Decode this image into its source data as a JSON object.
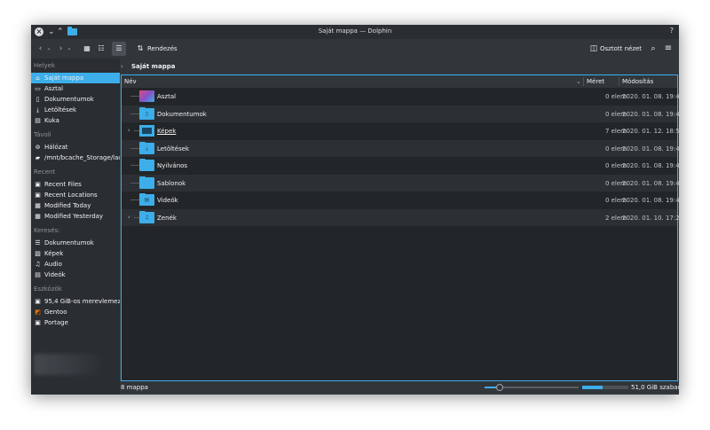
{
  "window": {
    "title": "Saját mappa — Dolphin",
    "help": "?"
  },
  "toolbar": {
    "sort_label": "Rendezés",
    "split_label": "Osztott nézet"
  },
  "sidebar": {
    "places_title": "Helyek",
    "places": [
      {
        "label": "Saját mappa",
        "icon": "home-icon",
        "selected": true
      },
      {
        "label": "Asztal",
        "icon": "desktop-icon"
      },
      {
        "label": "Dokumentumok",
        "icon": "documents-icon"
      },
      {
        "label": "Letöltések",
        "icon": "download-icon"
      },
      {
        "label": "Kuka",
        "icon": "trash-icon"
      }
    ],
    "remote_title": "Távoli",
    "remote": [
      {
        "label": "Hálózat",
        "icon": "network-icon"
      },
      {
        "label": "/mnt/bcache_Storage/lacy",
        "icon": "network-drive-icon"
      }
    ],
    "recent_title": "Recent",
    "recent": [
      {
        "label": "Recent Files",
        "icon": "recent-files-icon"
      },
      {
        "label": "Recent Locations",
        "icon": "recent-locations-icon"
      },
      {
        "label": "Modified Today",
        "icon": "calendar-icon"
      },
      {
        "label": "Modified Yesterday",
        "icon": "calendar-icon"
      }
    ],
    "search_title": "Keresés:",
    "search": [
      {
        "label": "Dokumentumok",
        "icon": "search-documents-icon"
      },
      {
        "label": "Képek",
        "icon": "search-images-icon"
      },
      {
        "label": "Audio",
        "icon": "music-note-icon"
      },
      {
        "label": "Videók",
        "icon": "video-icon"
      }
    ],
    "devices_title": "Eszközök",
    "devices": [
      {
        "label": "95,4 GiB-os merevlemez",
        "icon": "harddisk-icon"
      },
      {
        "label": "Gentoo",
        "icon": "gentoo-drive-icon"
      },
      {
        "label": "Portage",
        "icon": "drive-icon"
      }
    ]
  },
  "breadcrumb": {
    "label": "Saját mappa"
  },
  "columns": {
    "name": "Név",
    "size": "Méret",
    "modified": "Módosítás"
  },
  "rows": [
    {
      "name": "Asztal",
      "size": "0 elem",
      "modified": "2020. 01. 08. 19:45",
      "icon": "desktop-folder-icon"
    },
    {
      "name": "Dokumentumok",
      "size": "0 elem",
      "modified": "2020. 01. 08. 19:45",
      "icon": "documents-folder-icon"
    },
    {
      "name": "Képek",
      "size": "7 elem",
      "modified": "2020. 01. 12. 18:51",
      "icon": "pictures-folder-icon"
    },
    {
      "name": "Letöltések",
      "size": "0 elem",
      "modified": "2020. 01. 08. 19:45",
      "icon": "downloads-folder-icon"
    },
    {
      "name": "Nyilvános",
      "size": "0 elem",
      "modified": "2020. 01. 08. 19:45",
      "icon": "public-folder-icon"
    },
    {
      "name": "Sablonok",
      "size": "0 elem",
      "modified": "2020. 01. 08. 19:45",
      "icon": "templates-folder-icon"
    },
    {
      "name": "Videók",
      "size": "0 elem",
      "modified": "2020. 01. 08. 19:45",
      "icon": "videos-folder-icon"
    },
    {
      "name": "Zenék",
      "size": "2 elem",
      "modified": "2020. 01. 10. 17:27",
      "icon": "music-folder-icon"
    }
  ],
  "status": {
    "count": "8 mappa",
    "free": "51,0 GiB szabad",
    "zoom_fraction": 0.16,
    "disk_used_fraction": 0.45
  },
  "colors": {
    "accent": "#3daee9",
    "window_bg": "#31363b",
    "view_bg": "#232629",
    "sidebar_bg": "#2a2e32"
  }
}
